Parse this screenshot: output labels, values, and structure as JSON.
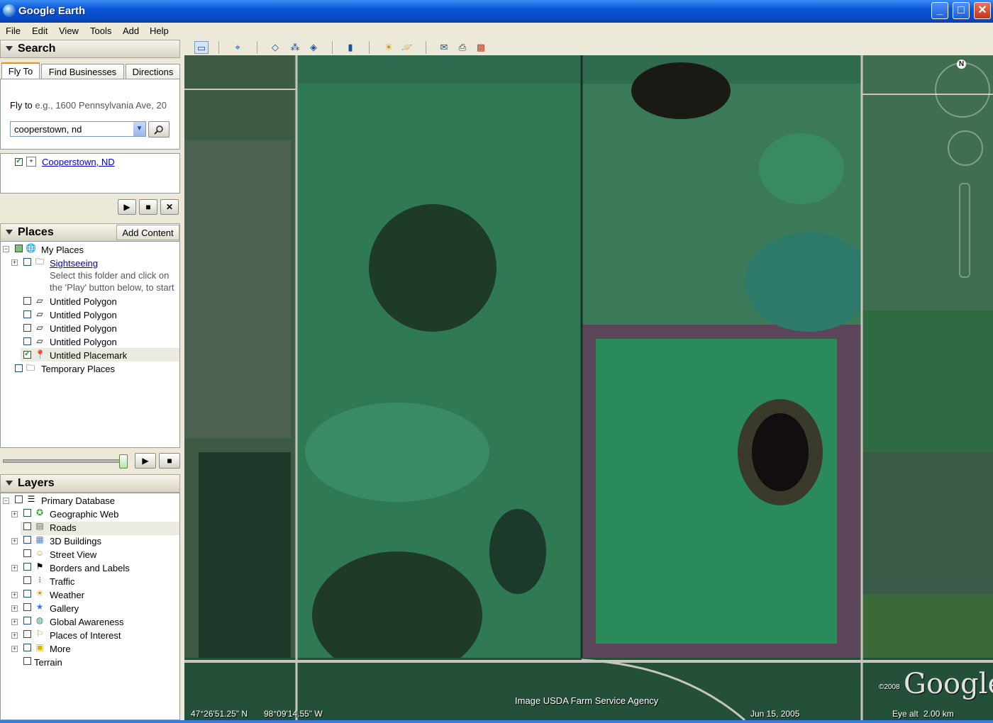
{
  "window": {
    "title": "Google Earth",
    "minimize": "_",
    "maximize": "□",
    "close": "✕"
  },
  "menu": [
    "File",
    "Edit",
    "View",
    "Tools",
    "Add",
    "Help"
  ],
  "search": {
    "header": "Search",
    "tabs": [
      "Fly To",
      "Find Businesses",
      "Directions"
    ],
    "fly_label": "Fly to",
    "fly_hint": "e.g., 1600 Pennsylvania Ave, 20",
    "query": "cooperstown, nd",
    "result": "Cooperstown, ND"
  },
  "places": {
    "header": "Places",
    "add_content": "Add Content",
    "my_places": "My Places",
    "sightseeing": "Sightseeing",
    "sightseeing_note_1": "Select this folder and click on",
    "sightseeing_note_2": "the 'Play' button below, to start",
    "items": [
      "Untitled Polygon",
      "Untitled Polygon",
      "Untitled Polygon",
      "Untitled Polygon",
      "Untitled Placemark"
    ],
    "temporary": "Temporary Places"
  },
  "layers": {
    "header": "Layers",
    "primary": "Primary Database",
    "items": [
      "Geographic Web",
      "Roads",
      "3D Buildings",
      "Street View",
      "Borders and Labels",
      "Traffic",
      "Weather",
      "Gallery",
      "Global Awareness",
      "Places of Interest",
      "More"
    ],
    "terrain": "Terrain"
  },
  "status": {
    "lat": "47°26'51.25\" N",
    "lon": "98°09'14.55\" W",
    "credit": "Image USDA Farm Service Agency",
    "date": "Jun 15, 2005",
    "eye_alt_label": "Eye alt",
    "eye_alt": "2.00 km",
    "copyright": "©2008",
    "brand": "Google",
    "compass_n": "N"
  }
}
